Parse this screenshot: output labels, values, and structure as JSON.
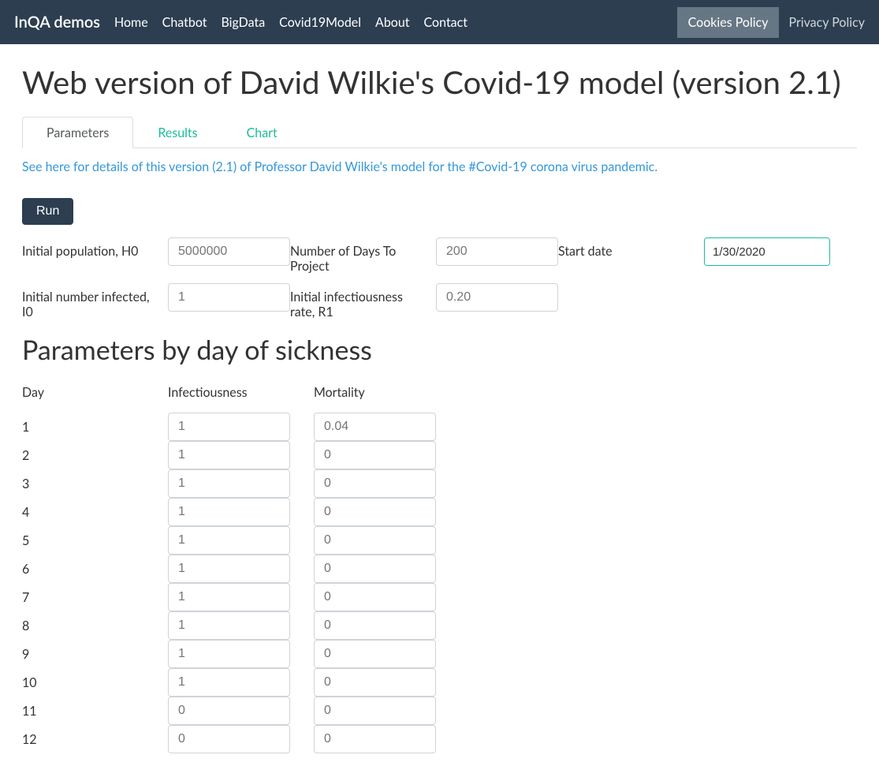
{
  "navbar": {
    "brand": "InQA demos",
    "links": [
      "Home",
      "Chatbot",
      "BigData",
      "Covid19Model",
      "About",
      "Contact"
    ],
    "cookies": "Cookies Policy",
    "privacy": "Privacy Policy"
  },
  "page": {
    "title": "Web version of David Wilkie's Covid-19 model (version 2.1)",
    "infoLink": "See here for details of this version (2.1) of Professor David Wilkie's model for the #Covid-19 corona virus pandemic.",
    "runLabel": "Run",
    "subTitle": "Parameters by day of sickness"
  },
  "tabs": [
    {
      "label": "Parameters",
      "active": true
    },
    {
      "label": "Results",
      "active": false
    },
    {
      "label": "Chart",
      "active": false
    }
  ],
  "params": {
    "row1": [
      {
        "label": "Initial population, H0",
        "placeholder": "5000000"
      },
      {
        "label": "Number of Days To Project",
        "placeholder": "200"
      },
      {
        "label": "Start date",
        "value": "1/30/2020",
        "isDate": true
      }
    ],
    "row2": [
      {
        "label": "Initial number infected, I0",
        "placeholder": "1"
      },
      {
        "label": "Initial infectiousness rate, R1",
        "placeholder": "0.20"
      }
    ]
  },
  "dayTable": {
    "headers": [
      "Day",
      "Infectiousness",
      "Mortality"
    ],
    "rows": [
      {
        "day": "1",
        "infectiousness": "1",
        "mortality": "0.04"
      },
      {
        "day": "2",
        "infectiousness": "1",
        "mortality": "0"
      },
      {
        "day": "3",
        "infectiousness": "1",
        "mortality": "0"
      },
      {
        "day": "4",
        "infectiousness": "1",
        "mortality": "0"
      },
      {
        "day": "5",
        "infectiousness": "1",
        "mortality": "0"
      },
      {
        "day": "6",
        "infectiousness": "1",
        "mortality": "0"
      },
      {
        "day": "7",
        "infectiousness": "1",
        "mortality": "0"
      },
      {
        "day": "8",
        "infectiousness": "1",
        "mortality": "0"
      },
      {
        "day": "9",
        "infectiousness": "1",
        "mortality": "0"
      },
      {
        "day": "10",
        "infectiousness": "1",
        "mortality": "0"
      },
      {
        "day": "11",
        "infectiousness": "0",
        "mortality": "0"
      },
      {
        "day": "12",
        "infectiousness": "0",
        "mortality": "0"
      }
    ]
  }
}
